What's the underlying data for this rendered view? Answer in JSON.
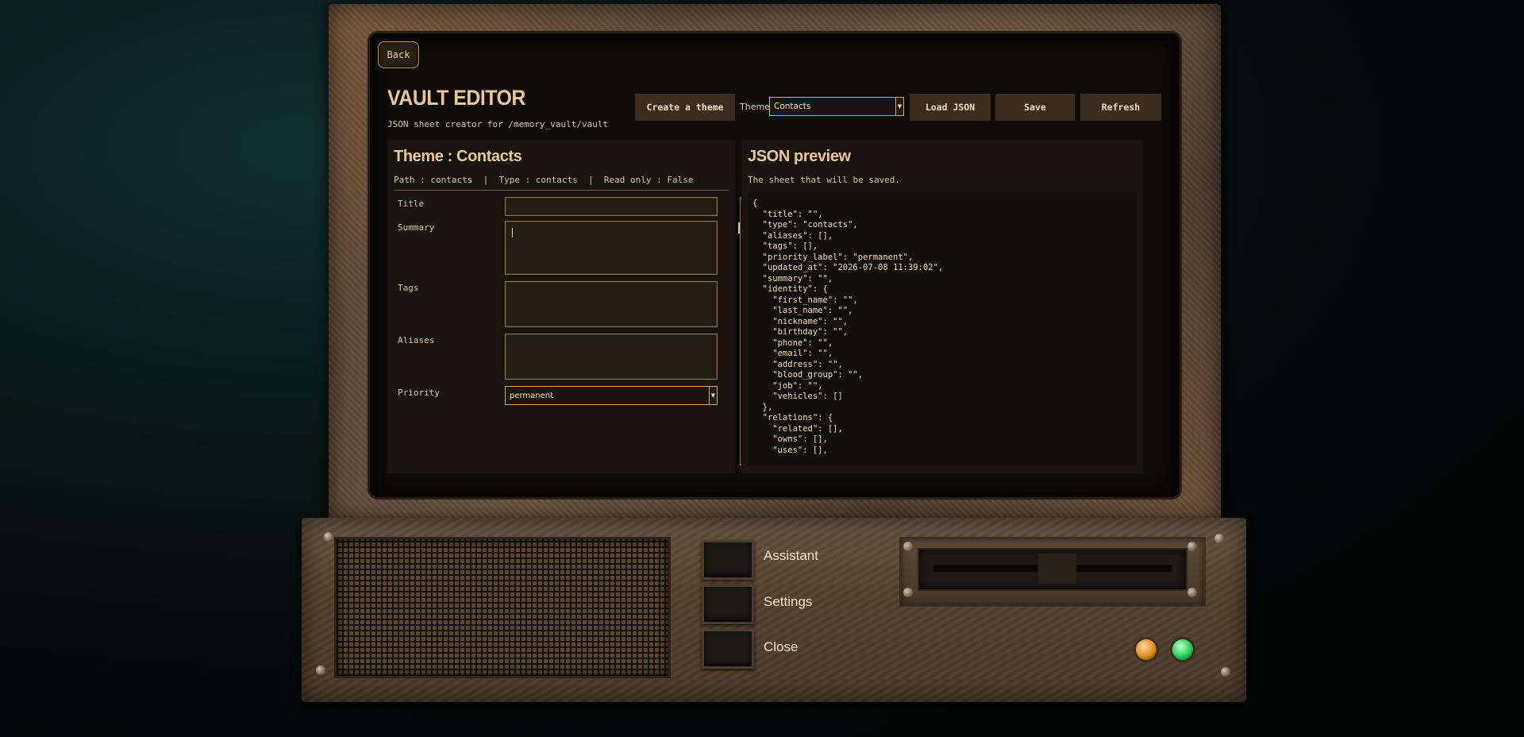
{
  "nav": {
    "back_label": "Back"
  },
  "header": {
    "title": "VAULT EDITOR",
    "subtitle": "JSON sheet creator for /memory_vault/vault"
  },
  "toolbar": {
    "create_label": "Create a theme",
    "theme_label": "Theme",
    "theme_value": "Contacts",
    "load_label": "Load JSON",
    "save_label": "Save",
    "refresh_label": "Refresh"
  },
  "editor": {
    "title": "Theme : Contacts",
    "meta": "Path : contacts  |  Type : contacts  |  Read only : False",
    "fields": {
      "title": "Title",
      "summary": "Summary",
      "tags": "Tags",
      "aliases": "Aliases",
      "priority": "Priority",
      "priority_value": "permanent"
    }
  },
  "preview": {
    "title": "JSON preview",
    "subtitle": "The sheet that will be saved.",
    "json": "{\n  \"title\": \"\",\n  \"type\": \"contacts\",\n  \"aliases\": [],\n  \"tags\": [],\n  \"priority_label\": \"permanent\",\n  \"updated_at\": \"2026-07-08 11:39:02\",\n  \"summary\": \"\",\n  \"identity\": {\n    \"first_name\": \"\",\n    \"last_name\": \"\",\n    \"nickname\": \"\",\n    \"birthday\": \"\",\n    \"phone\": \"\",\n    \"email\": \"\",\n    \"address\": \"\",\n    \"blood_group\": \"\",\n    \"job\": \"\",\n    \"vehicles\": []\n  },\n  \"relations\": {\n    \"related\": [],\n    \"owns\": [],\n    \"uses\": [],"
  },
  "console": {
    "assistant_label": "Assistant",
    "settings_label": "Settings",
    "close_label": "Close",
    "led_colors": {
      "amber": "#e08a1e",
      "green": "#2ecc5a"
    }
  }
}
